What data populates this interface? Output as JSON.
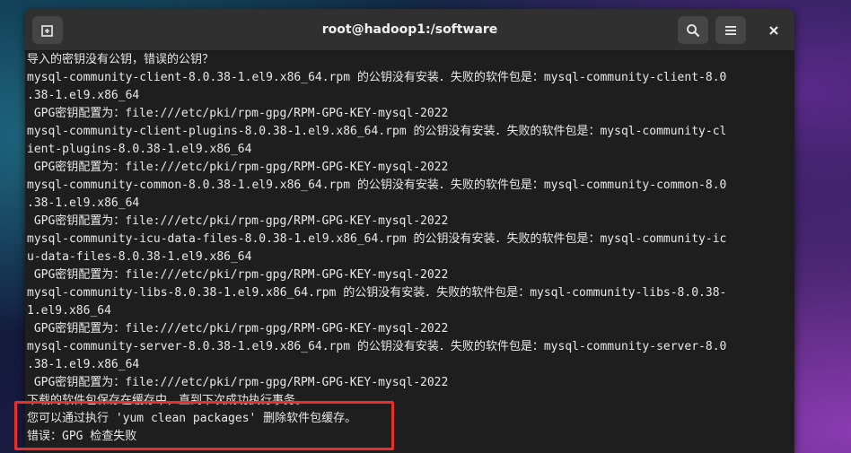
{
  "window": {
    "title": "root@hadoop1:/software",
    "new_tab_icon": "new-tab-icon",
    "search_icon": "search-icon",
    "menu_icon": "hamburger-menu-icon",
    "close_icon": "close-icon"
  },
  "terminal": {
    "lines": [
      "导入的密钥没有公钥，错误的公钥？",
      "mysql-community-client-8.0.38-1.el9.x86_64.rpm 的公钥没有安装．失败的软件包是：mysql-community-client-8.0",
      ".38-1.el9.x86_64",
      " GPG密钥配置为：file:///etc/pki/rpm-gpg/RPM-GPG-KEY-mysql-2022",
      "mysql-community-client-plugins-8.0.38-1.el9.x86_64.rpm 的公钥没有安装．失败的软件包是：mysql-community-cl",
      "ient-plugins-8.0.38-1.el9.x86_64",
      " GPG密钥配置为：file:///etc/pki/rpm-gpg/RPM-GPG-KEY-mysql-2022",
      "mysql-community-common-8.0.38-1.el9.x86_64.rpm 的公钥没有安装．失败的软件包是：mysql-community-common-8.0",
      ".38-1.el9.x86_64",
      " GPG密钥配置为：file:///etc/pki/rpm-gpg/RPM-GPG-KEY-mysql-2022",
      "mysql-community-icu-data-files-8.0.38-1.el9.x86_64.rpm 的公钥没有安装．失败的软件包是：mysql-community-ic",
      "u-data-files-8.0.38-1.el9.x86_64",
      " GPG密钥配置为：file:///etc/pki/rpm-gpg/RPM-GPG-KEY-mysql-2022",
      "mysql-community-libs-8.0.38-1.el9.x86_64.rpm 的公钥没有安装．失败的软件包是：mysql-community-libs-8.0.38-",
      "1.el9.x86_64",
      " GPG密钥配置为：file:///etc/pki/rpm-gpg/RPM-GPG-KEY-mysql-2022",
      "mysql-community-server-8.0.38-1.el9.x86_64.rpm 的公钥没有安装．失败的软件包是：mysql-community-server-8.0",
      ".38-1.el9.x86_64",
      " GPG密钥配置为：file:///etc/pki/rpm-gpg/RPM-GPG-KEY-mysql-2022",
      "下载的软件包保存在缓存中，直到下次成功执行事务。",
      "您可以通过执行 'yum clean packages' 删除软件包缓存。",
      "错误：GPG 检查失败"
    ]
  },
  "colors": {
    "highlight_border": "#e8302a",
    "terminal_bg": "#1e1e1e",
    "terminal_fg": "#e8e8e8",
    "titlebar_bg": "#303030"
  }
}
